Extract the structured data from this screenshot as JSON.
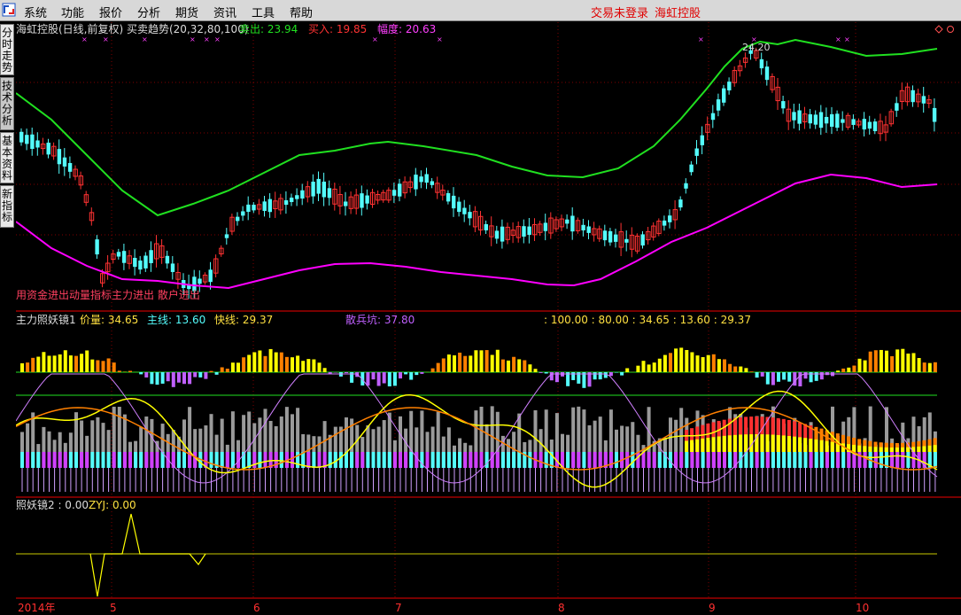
{
  "menu": [
    "系统",
    "功能",
    "报价",
    "分析",
    "期货",
    "资讯",
    "工具",
    "帮助"
  ],
  "status": {
    "login": "交易未登录",
    "stock": "海虹控股"
  },
  "side_tabs": [
    "分时走势",
    "技术分析",
    "基本资料",
    "新指标"
  ],
  "main_panel": {
    "title": "海虹控股(日线,前复权) 买卖趋势(20,32,80,100)",
    "sell": "卖出: 23.94",
    "buy": "买入: 19.85",
    "amp": "幅度: 20.63",
    "peak_label": "24.20",
    "bottom_text": "用资金进出动量指标主力进出 散户进出"
  },
  "panel2": {
    "title": "主力照妖镜1",
    "price_vol": "价量: 34.65",
    "main_line": "主线: 13.60",
    "fast_line": "快线: 29.37",
    "scatter": "散兵坑: 37.80",
    "values": ": 100.00 : 80.00 : 34.65  : 13.60  : 29.37"
  },
  "panel3": {
    "title": "照妖镜2 : 0.00",
    "zyj": "ZYJ: 0.00"
  },
  "x_axis": [
    "2014年",
    "5",
    "6",
    "7",
    "8",
    "9",
    "10"
  ],
  "colors": {
    "up": "#ff3232",
    "down": "#54fcfc",
    "ma_green": "#20e020",
    "ma_magenta": "#ff00ff",
    "yellow": "#ffff00",
    "orange": "#ff8000",
    "violet": "#c060ff",
    "grid": "#7f0000"
  }
}
